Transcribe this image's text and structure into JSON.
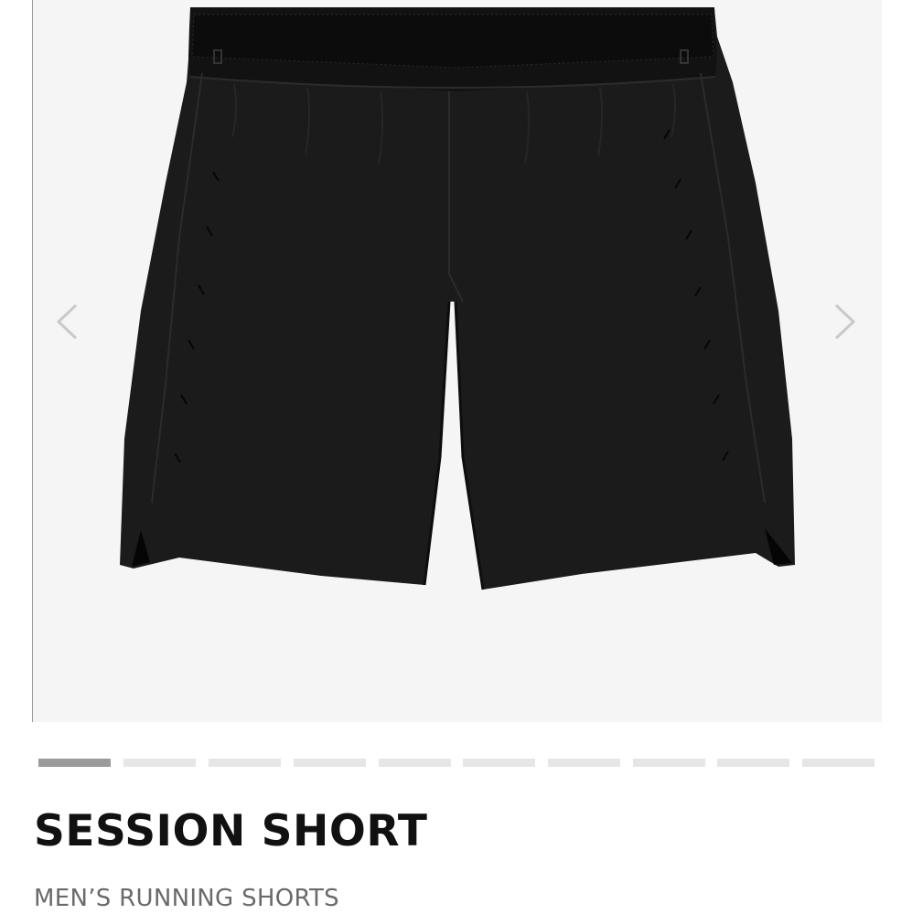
{
  "product": {
    "name": "SESSION SHORT",
    "category": "MEN’S RUNNING SHORTS",
    "image": {
      "alt": "Black men's running shorts with mesh waistband and laser-cut ventilation marks"
    }
  },
  "gallery": {
    "prev_icon": "chevron-left-icon",
    "next_icon": "chevron-right-icon",
    "image_count": 10,
    "active_index": 0
  },
  "colors": {
    "product": "#1a1a1a",
    "active_dot": "#9b9b9b",
    "inactive_dot": "#e6e6e6",
    "background": "#f5f5f5"
  }
}
